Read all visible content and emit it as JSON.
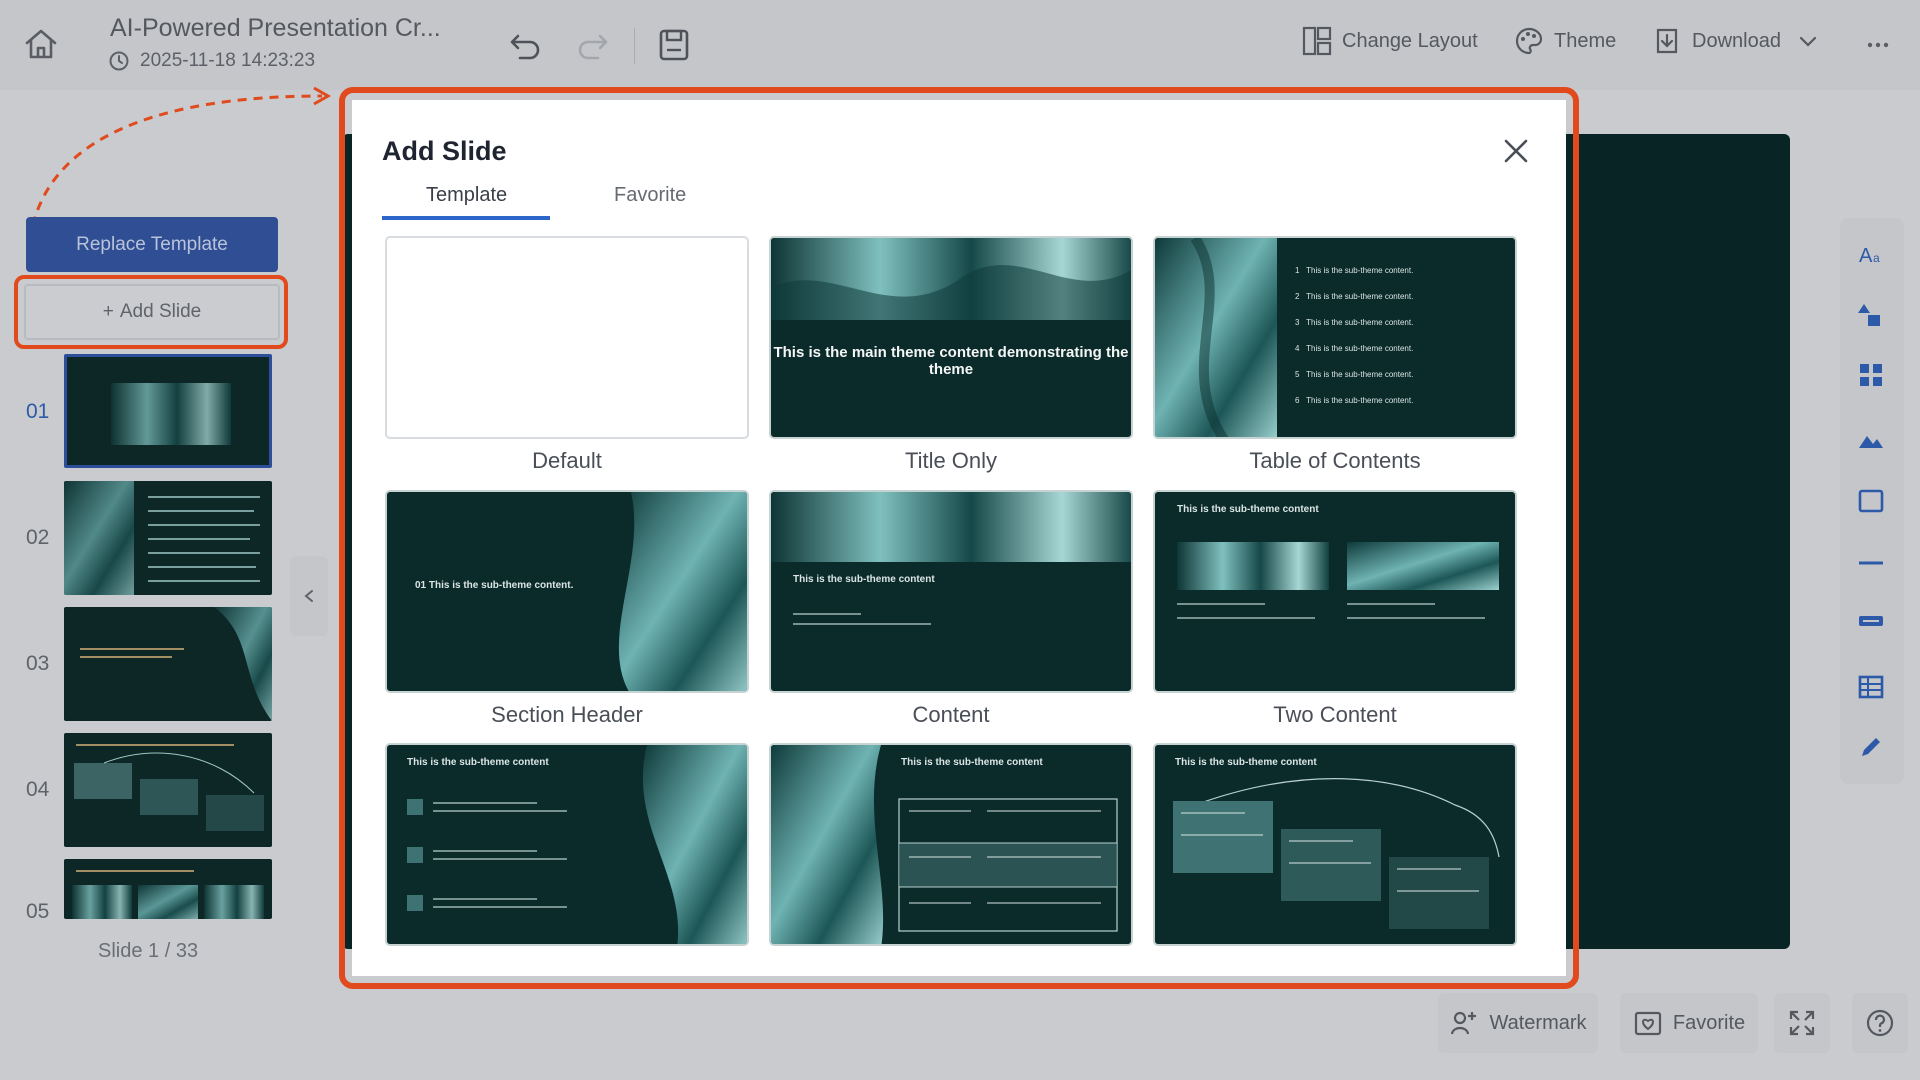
{
  "header": {
    "doc_title": "AI-Powered Presentation Cr...",
    "timestamp": "2025-11-18 14:23:23",
    "actions": [
      {
        "label": "Change Layout",
        "icon": "layout-icon"
      },
      {
        "label": "Theme",
        "icon": "palette-icon"
      },
      {
        "label": "Download",
        "icon": "download-icon"
      }
    ]
  },
  "sidebar": {
    "replace_label": "Replace Template",
    "add_label": "Add Slide",
    "add_prefix": "+",
    "slides": [
      {
        "num": "01"
      },
      {
        "num": "02"
      },
      {
        "num": "03"
      },
      {
        "num": "04"
      },
      {
        "num": "05"
      }
    ],
    "counter": "Slide 1 / 33"
  },
  "bottom": {
    "watermark": "Watermark",
    "favorite": "Favorite"
  },
  "modal": {
    "title": "Add Slide",
    "tabs": [
      "Template",
      "Favorite"
    ],
    "templates": [
      {
        "label": "Default"
      },
      {
        "label": "Title Only",
        "text": "This is the main theme content demonstrating the theme"
      },
      {
        "label": "Table of Contents",
        "items": [
          "1",
          "2",
          "3",
          "4",
          "5",
          "6"
        ],
        "item_text": "This is the sub-theme content."
      },
      {
        "label": "Section Header",
        "text": "01  This is the sub-theme content."
      },
      {
        "label": "Content",
        "text": "This is the sub-theme content"
      },
      {
        "label": "Two Content",
        "text": "This is the sub-theme content"
      },
      {
        "label": "",
        "text": "This is the sub-theme content"
      },
      {
        "label": "",
        "text": "This is the sub-theme content"
      },
      {
        "label": "",
        "text": "This is the sub-theme content"
      }
    ]
  },
  "colors": {
    "accent": "#e04a1c",
    "primary": "#2f4e93",
    "slide_bg": "#0b2a2a",
    "tab_active": "#2d66c9"
  }
}
